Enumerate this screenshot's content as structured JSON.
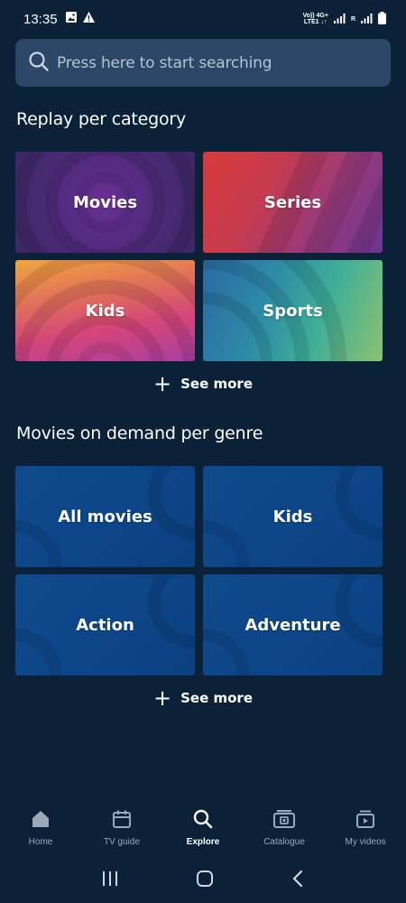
{
  "status_bar": {
    "time": "13:35",
    "icons": [
      "image-icon",
      "alert-icon"
    ],
    "network_top": "Vo)) 4G+",
    "network_bottom": "LTE1 ↓↑",
    "sim_label": "R"
  },
  "search": {
    "placeholder": "Press here to start searching",
    "icon": "search-icon"
  },
  "replay": {
    "title": "Replay per category",
    "tiles": [
      {
        "label": "Movies"
      },
      {
        "label": "Series"
      },
      {
        "label": "Kids"
      },
      {
        "label": "Sports"
      }
    ],
    "see_more": "See more"
  },
  "movies_on_demand": {
    "title": "Movies on demand per genre",
    "tiles": [
      {
        "label": "All movies"
      },
      {
        "label": "Kids"
      },
      {
        "label": "Action"
      },
      {
        "label": "Adventure"
      }
    ],
    "see_more": "See more"
  },
  "bottom_nav": {
    "items": [
      {
        "label": "Home",
        "icon": "home-icon",
        "active": false
      },
      {
        "label": "TV guide",
        "icon": "calendar-icon",
        "active": false
      },
      {
        "label": "Explore",
        "icon": "search-icon",
        "active": true
      },
      {
        "label": "Catalogue",
        "icon": "catalogue-icon",
        "active": false
      },
      {
        "label": "My videos",
        "icon": "my-videos-icon",
        "active": false
      }
    ]
  },
  "colors": {
    "background": "#0b2137",
    "search_bg": "#2b4666",
    "genre_tile": "#0f4a8c",
    "nav_inactive": "#9aa8b9"
  }
}
